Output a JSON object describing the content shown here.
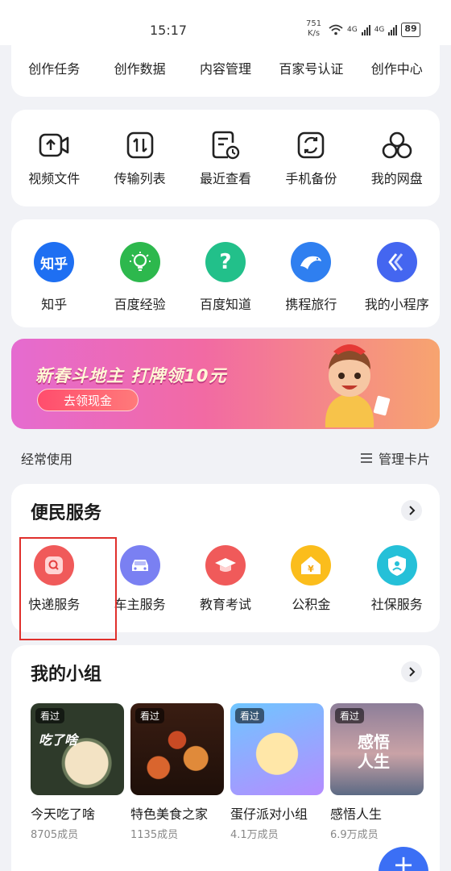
{
  "status_bar": {
    "time": "15:17",
    "speed": "751",
    "speed_unit": "K/s",
    "net1": "4G",
    "net2": "4G",
    "battery": "89"
  },
  "creator_row": [
    "创作任务",
    "创作数据",
    "内容管理",
    "百家号认证",
    "创作中心"
  ],
  "tools": [
    {
      "label": "视频文件",
      "icon": "video-icon"
    },
    {
      "label": "传输列表",
      "icon": "transfer-icon"
    },
    {
      "label": "最近查看",
      "icon": "recent-icon"
    },
    {
      "label": "手机备份",
      "icon": "backup-icon"
    },
    {
      "label": "我的网盘",
      "icon": "cloud-drive-icon"
    }
  ],
  "apps": [
    {
      "label": "知乎",
      "icon_text": "知乎",
      "color": "#1e6ff2"
    },
    {
      "label": "百度经验",
      "color": "#2db84d"
    },
    {
      "label": "百度知道",
      "icon_text": "?",
      "color": "#22c08a"
    },
    {
      "label": "携程旅行",
      "color": "#2f7ff0"
    },
    {
      "label": "我的小程序",
      "color": "#4466f0"
    }
  ],
  "banner": {
    "title": "新春斗地主 打牌领10元",
    "button": "去领现金"
  },
  "frequent": {
    "label": "经常使用",
    "manage": "管理卡片"
  },
  "services": {
    "title": "便民服务",
    "items": [
      {
        "label": "快递服务",
        "color": "#f05a5a"
      },
      {
        "label": "车主服务",
        "color": "#7a80f2"
      },
      {
        "label": "教育考试",
        "color": "#f05a5a"
      },
      {
        "label": "公积金",
        "color": "#fbbd1c"
      },
      {
        "label": "社保服务",
        "color": "#25c0d8"
      }
    ]
  },
  "my_groups": {
    "title": "我的小组",
    "seen_label": "看过",
    "items": [
      {
        "name": "今天吃了啥",
        "members": "8705成员",
        "thumb_text": "吃了啥"
      },
      {
        "name": "特色美食之家",
        "members": "1135成员",
        "thumb_text": ""
      },
      {
        "name": "蛋仔派对小组",
        "members": "4.1万成员",
        "thumb_text": ""
      },
      {
        "name": "感悟人生",
        "members": "6.9万成员",
        "thumb_text": "感悟人生"
      }
    ]
  }
}
